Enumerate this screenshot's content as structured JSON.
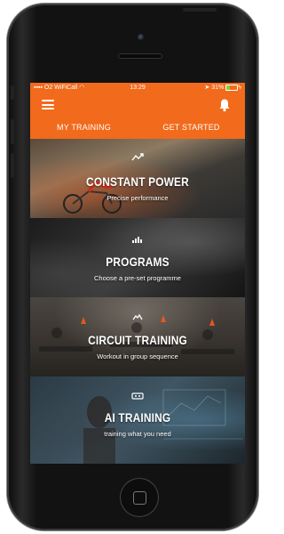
{
  "status_bar": {
    "carrier": "O2 WiFiCall",
    "time": "13:29",
    "battery": "31%"
  },
  "tabs": [
    {
      "label": "MY TRAINING"
    },
    {
      "label": "GET STARTED"
    }
  ],
  "cards": [
    {
      "title": "CONSTANT POWER",
      "subtitle": "Precise performance",
      "icon": "power-icon"
    },
    {
      "title": "PROGRAMS",
      "subtitle": "Choose a pre-set programme",
      "icon": "programs-icon"
    },
    {
      "title": "CIRCUIT TRAINING",
      "subtitle": "Workout in group sequence",
      "icon": "circuit-icon"
    },
    {
      "title": "AI TRAINING",
      "subtitle": "training what you need",
      "icon": "ai-icon"
    }
  ],
  "colors": {
    "accent": "#f26a1b",
    "text": "#ffffff"
  }
}
